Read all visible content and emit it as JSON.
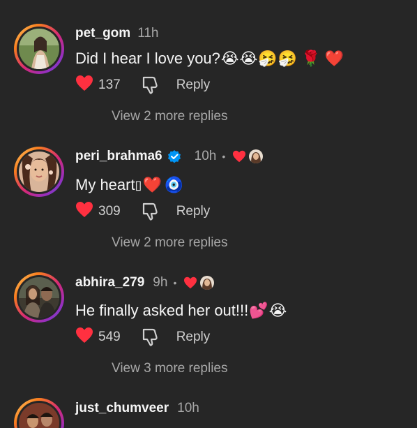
{
  "comments": [
    {
      "username": "pet_gom",
      "time": "11h",
      "text": "Did I hear I love you?",
      "emojis": [
        "😭",
        "😭",
        "🤧",
        "🤧",
        "🌹",
        "❤️"
      ],
      "likes": "137",
      "reply_label": "Reply",
      "view_replies": "View 2 more replies"
    },
    {
      "username": "peri_brahma6",
      "time": "10h",
      "dot": "•",
      "text": "My heart",
      "emojis": [
        "❤️",
        "🧿"
      ],
      "missing_glyph": "▯",
      "likes": "309",
      "reply_label": "Reply",
      "view_replies": "View 2 more replies"
    },
    {
      "username": "abhira_279",
      "time": "9h",
      "dot": "•",
      "text": "He finally asked her out!!!",
      "emojis": [
        "💕",
        "😭"
      ],
      "likes": "549",
      "reply_label": "Reply",
      "view_replies": "View 3 more replies"
    },
    {
      "username": "just_chumveer",
      "time": "10h"
    }
  ],
  "colors": {
    "background": "#262626",
    "like_red": "#ff3040",
    "verified_blue": "#0095f6",
    "muted": "#a8a8a8"
  }
}
